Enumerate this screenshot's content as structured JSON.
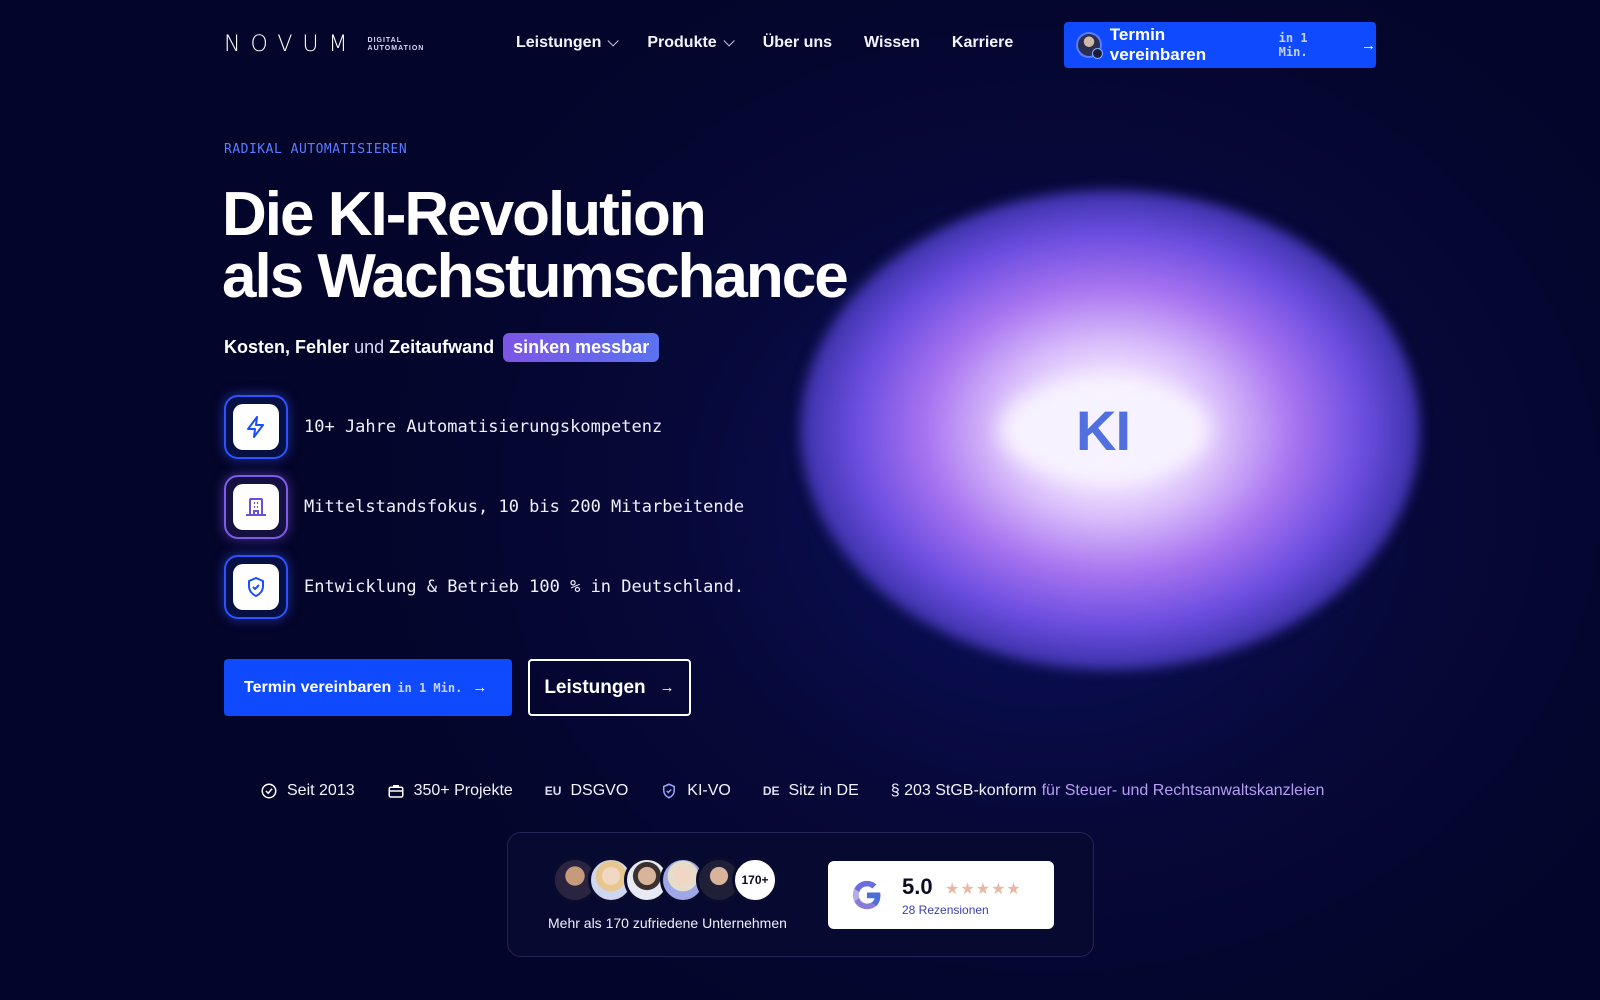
{
  "header": {
    "logo_word": "NOVUM",
    "logo_sub_1": "DIGITAL",
    "logo_sub_2": "AUTOMATION",
    "nav": [
      {
        "label": "Leistungen",
        "dropdown": true
      },
      {
        "label": "Produkte",
        "dropdown": true
      },
      {
        "label": "Über uns",
        "dropdown": false
      },
      {
        "label": "Wissen",
        "dropdown": false
      },
      {
        "label": "Karriere",
        "dropdown": false
      }
    ],
    "cta": {
      "label": "Termin vereinbaren",
      "meta": "in 1 Min.",
      "arrow": "→"
    }
  },
  "hero": {
    "eyebrow": "RADIKAL AUTOMATISIEREN",
    "headline_1_plain": "Die ",
    "headline_1_bold": "KI-Revolution",
    "headline_2": "als Wachstumschance",
    "sub": {
      "w1": "Kosten",
      "sep1": ",",
      "w2": "Fehler",
      "and": "und",
      "w3": "Zeitaufwand",
      "pill": "sinken messbar"
    },
    "features": [
      {
        "icon": "lightning-icon",
        "text": "10+ Jahre Automatisierungskompetenz"
      },
      {
        "icon": "building-icon",
        "text": "Mittelstandsfokus, 10 bis 200 Mitarbeitende"
      },
      {
        "icon": "shield-check-icon",
        "text": "Entwicklung & Betrieb 100 % in Deutschland."
      }
    ],
    "primary_button": {
      "label": "Termin vereinbaren",
      "meta": "in 1 Min.",
      "arrow": "→"
    },
    "secondary_button": {
      "label": "Leistungen",
      "arrow": "→"
    },
    "orb_text": "KI"
  },
  "trust": [
    {
      "icon": "check-circle-icon",
      "label": "Seit 2013"
    },
    {
      "icon": "briefcase-icon",
      "label": "350+ Projekte"
    },
    {
      "code": "EU",
      "label": "DSGVO"
    },
    {
      "icon": "shield-icon",
      "label": "KI-VO"
    },
    {
      "code": "DE",
      "label": "Sitz in DE"
    },
    {
      "label": "§ 203 StGB-konform",
      "accent": "für Steuer- und Rechtsanwaltskanzleien"
    }
  ],
  "reviews": {
    "count_badge": "170+",
    "caption": "Mehr als 170 zufriedene Unternehmen",
    "google_rating": "5.0",
    "stars": "★★★★★",
    "review_count": "28 Rezensionen"
  },
  "colors": {
    "background": "#04052a",
    "primary": "#0f4aff",
    "eyebrow": "#5b7cff",
    "pill_start": "#7c55e6",
    "pill_end": "#5b72f0",
    "accent_text": "#b79df3"
  }
}
